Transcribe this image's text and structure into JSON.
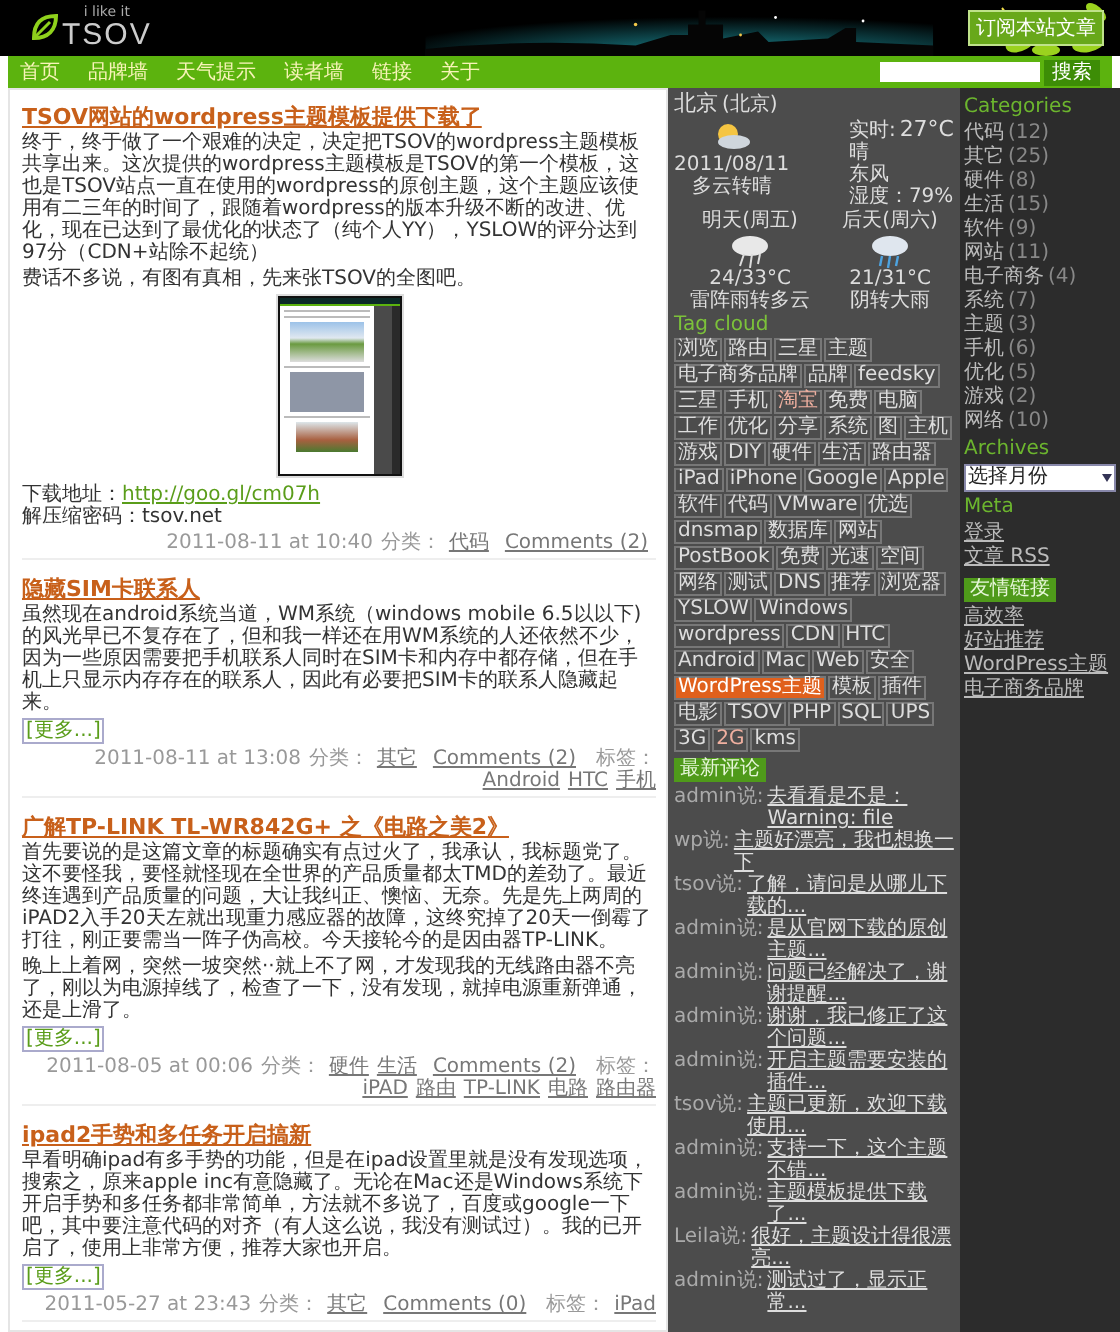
{
  "header": {
    "logo": "TSOV",
    "tagline": "i like it",
    "rss_button": "订阅本站文章"
  },
  "nav": {
    "items": [
      "首页",
      "品牌墙",
      "天气提示",
      "读者墙",
      "链接",
      "关于"
    ],
    "search_button": "搜索"
  },
  "posts": [
    {
      "title": "TSOV网站的wordpress主题模板提供下载了",
      "blocks": [
        {
          "kind": "text",
          "text": "终于，终于做了一个艰难的决定，决定把TSOV的wordpress主题模板共享出来。这次提供的wordpress主题模板是TSOV的第一个模板，这也是TSOV站点一直在使用的wordpress的原创主题，这个主题应该使用有二三年的时间了，跟随着wordpress的版本升级不断的改进、优化，现在已达到了最优化的状态了（纯个人YY），YSLOW的评分达到97分（CDN+站除不起统）"
        },
        {
          "kind": "text",
          "text": "费话不多说，有图有真相，先来张TSOV的全图吧。"
        },
        {
          "kind": "screenshot"
        },
        {
          "kind": "link",
          "label": "下载地址：",
          "text": "http://goo.gl/cm07h"
        },
        {
          "kind": "line",
          "label": "解压缩密码：",
          "text": "tsov.net"
        }
      ],
      "date": "2011-08-11 at 10:40",
      "category_label": "分类：",
      "categories": [
        "代码"
      ],
      "comments": "Comments (2)"
    },
    {
      "title": "隐藏SIM卡联系人",
      "blocks": [
        {
          "kind": "text",
          "text": "虽然现在android系统当道，WM系统（windows mobile 6.5以以下)的风光早已不复存在了，但和我一样还在用WM系统的人还依然不少，因为一些原因需要把手机联系人同时在SIM卡和内存中都存储，但在手机上只显示内存存在的联系人，因此有必要把SIM卡的联系人隐藏起来。",
          "more": "[更多...]"
        }
      ],
      "date": "2011-08-11 at 13:08",
      "category_label": "分类：",
      "categories": [
        "其它"
      ],
      "comments": "Comments (2)",
      "tags_label": "标签：",
      "tags": [
        "Android",
        "HTC",
        "手机"
      ]
    },
    {
      "title": "广解TP-LINK TL-WR842G+ 之《电路之美2》",
      "blocks": [
        {
          "kind": "text",
          "text": "首先要说的是这篇文章的标题确实有点过火了，我承认，我标题党了。这不要怪我，要怪就怪现在全世界的产品质量都太TMD的差劲了。最近终连遇到产品质量的问题，大让我纠正、懊恼、无奈。先是先上两周的iPAD2入手20天左就出现重力感应器的故障，这终究掉了20天一倒霉了打往，刚正要需当一阵子伪高校。今天接轮今的是因由器TP-LINK。"
        },
        {
          "kind": "text",
          "text": "晚上上着网，突然一坡突然··就上不了网，才发现我的无线路由器不亮了，刚以为电源掉线了，检查了一下，没有发现，就掉电源重新弹通，还是上滑了。",
          "more": "[更多...]"
        }
      ],
      "date": "2011-08-05 at 00:06",
      "category_label": "分类：",
      "categories": [
        "硬件",
        "生活"
      ],
      "comments": "Comments (2)",
      "tags_label": "标签：",
      "tags": [
        "iPAD",
        "路由",
        "TP-LINK",
        "电路",
        "路由器"
      ]
    },
    {
      "title": "ipad2手势和多任务开启搞新",
      "blocks": [
        {
          "kind": "text",
          "text": "早看明确ipad有多手势的功能，但是在ipad设置里就是没有发现选项，搜索之，原来apple inc有意隐藏了。无论在Mac还是Windows系统下开启手势和多任务都非常简单，方法就不多说了，百度或google一下吧，其中要注意代码的对齐（有人这么说，我没有测试过）。我的已开启了，使用上非常方便，推荐大家也开启。",
          "more": "[更多...]"
        }
      ],
      "date": "2011-05-27 at 23:43",
      "category_label": "分类：",
      "categories": [
        "其它"
      ],
      "comments": "Comments (0)",
      "tags_label": "标签：",
      "tags": [
        "iPad"
      ]
    }
  ],
  "weather": {
    "city": "北京",
    "city_note": "(北京)",
    "today": {
      "kind": "sun_cloud",
      "date": "2011/08/11",
      "summary": "多云转晴",
      "temp_label": "实时:",
      "temp": "27°C",
      "condition": "晴",
      "wind": "东风",
      "humidity": "湿度：79%"
    },
    "forecast": [
      {
        "kind": "storm",
        "day": "明天(周五)",
        "range": "24/33°C",
        "summary": "雷阵雨转多云"
      },
      {
        "kind": "rain",
        "day": "后天(周六)",
        "range": "21/31°C",
        "summary": "阴转大雨"
      }
    ]
  },
  "tag_cloud": {
    "title": "Tag cloud",
    "tags": [
      {
        "text": "浏览",
        "kind": "normal"
      },
      {
        "text": "路由",
        "kind": "normal"
      },
      {
        "text": "三星",
        "kind": "normal"
      },
      {
        "text": "主题",
        "kind": "normal"
      },
      {
        "text": "电子商务品牌",
        "kind": "normal"
      },
      {
        "text": "品牌",
        "kind": "normal"
      },
      {
        "text": "feedsky",
        "kind": "normal"
      },
      {
        "text": "三星",
        "kind": "normal"
      },
      {
        "text": "手机",
        "kind": "normal"
      },
      {
        "text": "淘宝",
        "kind": "warm"
      },
      {
        "text": "免费",
        "kind": "normal"
      },
      {
        "text": "电脑",
        "kind": "normal"
      },
      {
        "text": "工作",
        "kind": "normal"
      },
      {
        "text": "优化",
        "kind": "normal"
      },
      {
        "text": "分享",
        "kind": "normal"
      },
      {
        "text": "系统",
        "kind": "normal"
      },
      {
        "text": "图",
        "kind": "normal"
      },
      {
        "text": "主机",
        "kind": "normal"
      },
      {
        "text": "游戏",
        "kind": "normal"
      },
      {
        "text": "DIY",
        "kind": "normal"
      },
      {
        "text": "硬件",
        "kind": "normal"
      },
      {
        "text": "生活",
        "kind": "normal"
      },
      {
        "text": "路由器",
        "kind": "normal"
      },
      {
        "text": "iPad",
        "kind": "normal"
      },
      {
        "text": "iPhone",
        "kind": "normal"
      },
      {
        "text": "Google",
        "kind": "normal"
      },
      {
        "text": "Apple",
        "kind": "normal"
      },
      {
        "text": "软件",
        "kind": "normal"
      },
      {
        "text": "代码",
        "kind": "normal"
      },
      {
        "text": "VMware",
        "kind": "normal"
      },
      {
        "text": "优选",
        "kind": "normal"
      },
      {
        "text": "dnsmap",
        "kind": "normal"
      },
      {
        "text": "数据库",
        "kind": "normal"
      },
      {
        "text": "网站",
        "kind": "normal"
      },
      {
        "text": "PostBook",
        "kind": "normal"
      },
      {
        "text": "免费",
        "kind": "normal"
      },
      {
        "text": "光速",
        "kind": "normal"
      },
      {
        "text": "空间",
        "kind": "normal"
      },
      {
        "text": "网络",
        "kind": "normal"
      },
      {
        "text": "测试",
        "kind": "normal"
      },
      {
        "text": "DNS",
        "kind": "normal"
      },
      {
        "text": "推荐",
        "kind": "normal"
      },
      {
        "text": "浏览器",
        "kind": "normal"
      },
      {
        "text": "YSLOW",
        "kind": "normal"
      },
      {
        "text": "Windows",
        "kind": "normal"
      },
      {
        "text": "wordpress",
        "kind": "normal"
      },
      {
        "text": "CDN",
        "kind": "normal"
      },
      {
        "text": "HTC",
        "kind": "normal"
      },
      {
        "text": "Android",
        "kind": "normal"
      },
      {
        "text": "Mac",
        "kind": "normal"
      },
      {
        "text": "Web",
        "kind": "normal"
      },
      {
        "text": "安全",
        "kind": "normal"
      },
      {
        "text": "WordPress主题",
        "kind": "hot"
      },
      {
        "text": "模板",
        "kind": "normal"
      },
      {
        "text": "插件",
        "kind": "normal"
      },
      {
        "text": "电影",
        "kind": "normal"
      },
      {
        "text": "TSOV",
        "kind": "normal"
      },
      {
        "text": "PHP",
        "kind": "normal"
      },
      {
        "text": "SQL",
        "kind": "normal"
      },
      {
        "text": "UPS",
        "kind": "normal"
      },
      {
        "text": "3G",
        "kind": "normal"
      },
      {
        "text": "2G",
        "kind": "warm"
      },
      {
        "text": "kms",
        "kind": "normal"
      }
    ]
  },
  "recent_comments": {
    "title": "最新评论",
    "items": [
      {
        "author": "admin说:",
        "text": "去看看是不是：Warning: file"
      },
      {
        "author": "wp说:",
        "text": "主题好漂亮，我也想换一下"
      },
      {
        "author": "tsov说:",
        "text": "了解，请问是从哪儿下载的..."
      },
      {
        "author": "admin说:",
        "text": "是从官网下载的原创主题..."
      },
      {
        "author": "admin说:",
        "text": "问题已经解决了，谢谢提醒..."
      },
      {
        "author": "admin说:",
        "text": "谢谢，我已修正了这个问题..."
      },
      {
        "author": "admin说:",
        "text": "开启主题需要安装的插件..."
      },
      {
        "author": "tsov说:",
        "text": "主题已更新，欢迎下载使用..."
      },
      {
        "author": "admin说:",
        "text": "支持一下，这个主题不错..."
      },
      {
        "author": "admin说:",
        "text": "主题模板提供下载了..."
      },
      {
        "author": "Leila说:",
        "text": "很好，主题设计得很漂亮..."
      },
      {
        "author": "admin说:",
        "text": "测试过了，显示正常..."
      }
    ]
  },
  "categories": {
    "title": "Categories",
    "items": [
      {
        "name": "代码",
        "count": "(12)"
      },
      {
        "name": "其它",
        "count": "(25)"
      },
      {
        "name": "硬件",
        "count": "(8)"
      },
      {
        "name": "生活",
        "count": "(15)"
      },
      {
        "name": "软件",
        "count": "(9)"
      },
      {
        "name": "网站",
        "count": "(11)"
      },
      {
        "name": "电子商务",
        "count": "(4)"
      },
      {
        "name": "系统",
        "count": "(7)"
      },
      {
        "name": "主题",
        "count": "(3)"
      },
      {
        "name": "手机",
        "count": "(6)"
      },
      {
        "name": "优化",
        "count": "(5)"
      },
      {
        "name": "游戏",
        "count": "(2)"
      },
      {
        "name": "网络",
        "count": "(10)"
      }
    ]
  },
  "archives": {
    "title": "Archives",
    "select": "选择月份"
  },
  "meta": {
    "title": "Meta",
    "items": [
      "登录",
      "文章 RSS"
    ]
  },
  "links": {
    "title": "友情链接",
    "items": [
      "高效率",
      "好站推荐",
      "WordPress主题",
      "电子商务品牌"
    ]
  }
}
